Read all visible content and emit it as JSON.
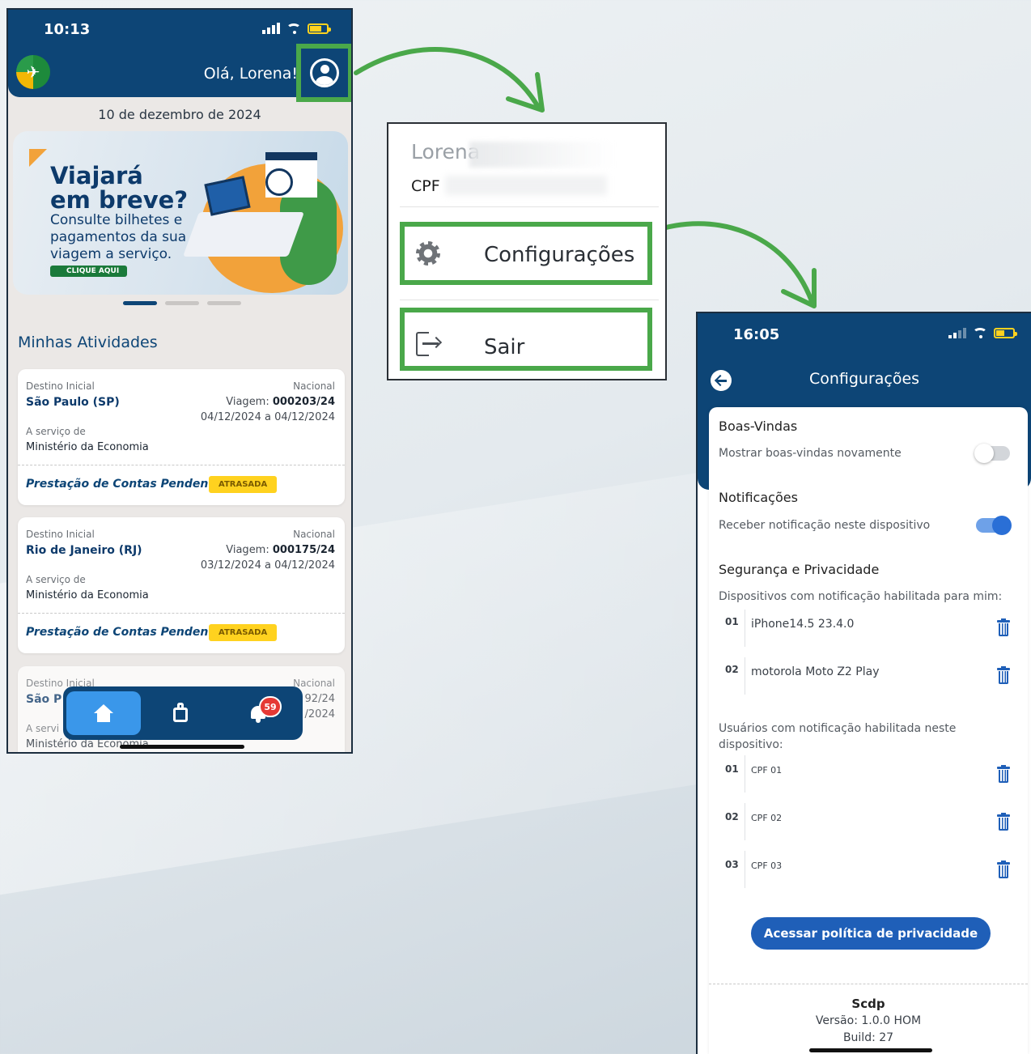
{
  "phone1": {
    "status": {
      "time": "10:13"
    },
    "header": {
      "greeting": "Olá, Lorena!"
    },
    "date": "10 de dezembro de 2024",
    "banner": {
      "title_line1": "Viajará",
      "title_line2": "em breve?",
      "subtitle": "Consulte bilhetes e pagamentos da sua viagem a serviço.",
      "cta": "CLIQUE AQUI"
    },
    "section_title": "Minhas Atividades",
    "activities": [
      {
        "destino_label": "Destino Inicial",
        "destino": "São Paulo (SP)",
        "tipo": "Nacional",
        "viagem_label": "Viagem:",
        "viagem": "000203/24",
        "periodo": "04/12/2024 a 04/12/2024",
        "servico_label": "A serviço de",
        "orgao": "Ministério da Economia",
        "pendencia": "Prestação de Contas Pendente",
        "badge": "ATRASADA"
      },
      {
        "destino_label": "Destino Inicial",
        "destino": "Rio de Janeiro (RJ)",
        "tipo": "Nacional",
        "viagem_label": "Viagem:",
        "viagem": "000175/24",
        "periodo": "03/12/2024 a 04/12/2024",
        "servico_label": "A serviço de",
        "orgao": "Ministério da Economia",
        "pendencia": "Prestação de Contas Pendente",
        "badge": "ATRASADA"
      },
      {
        "destino_label": "Destino Inicial",
        "destino": "São P",
        "tipo": "Nacional",
        "viagem_partial": "92/24",
        "periodo_partial": "/2024",
        "servico_label": "A servi",
        "orgao": "Ministério da Economia"
      }
    ],
    "tabbar": {
      "notification_count": "59"
    }
  },
  "menu": {
    "user_name": "Lorena",
    "cpf_label": "CPF",
    "items": [
      {
        "label": "Configurações",
        "icon": "gear-icon"
      },
      {
        "label": "Sair",
        "icon": "logout-icon"
      }
    ]
  },
  "phone2": {
    "status": {
      "time": "16:05"
    },
    "title": "Configurações",
    "sections": {
      "welcome": {
        "title": "Boas-Vindas",
        "row": "Mostrar boas-vindas novamente",
        "enabled": false
      },
      "notifications": {
        "title": "Notificações",
        "row": "Receber notificação neste dispositivo",
        "enabled": true
      },
      "security": {
        "title": "Segurança e Privacidade",
        "devices_label": "Dispositivos com notificação habilitada para mim:",
        "devices": [
          {
            "num": "01",
            "name": "iPhone14.5 23.4.0"
          },
          {
            "num": "02",
            "name": "motorola Moto Z2 Play"
          }
        ],
        "users_label": "Usuários com notificação habilitada neste dispositivo:",
        "users": [
          {
            "num": "01",
            "name": "CPF 01"
          },
          {
            "num": "02",
            "name": "CPF 02"
          },
          {
            "num": "03",
            "name": "CPF 03"
          }
        ]
      }
    },
    "policy_button": "Acessar política de privacidade",
    "footer": {
      "app": "Scdp",
      "version": "Versão: 1.0.0 HOM",
      "build": "Build: 27"
    }
  },
  "colors": {
    "primary": "#0d4576",
    "highlight": "#4aa84a",
    "badge": "#ffd21f",
    "toggle_on": "#2a6fd6",
    "button": "#1f5fb8"
  }
}
